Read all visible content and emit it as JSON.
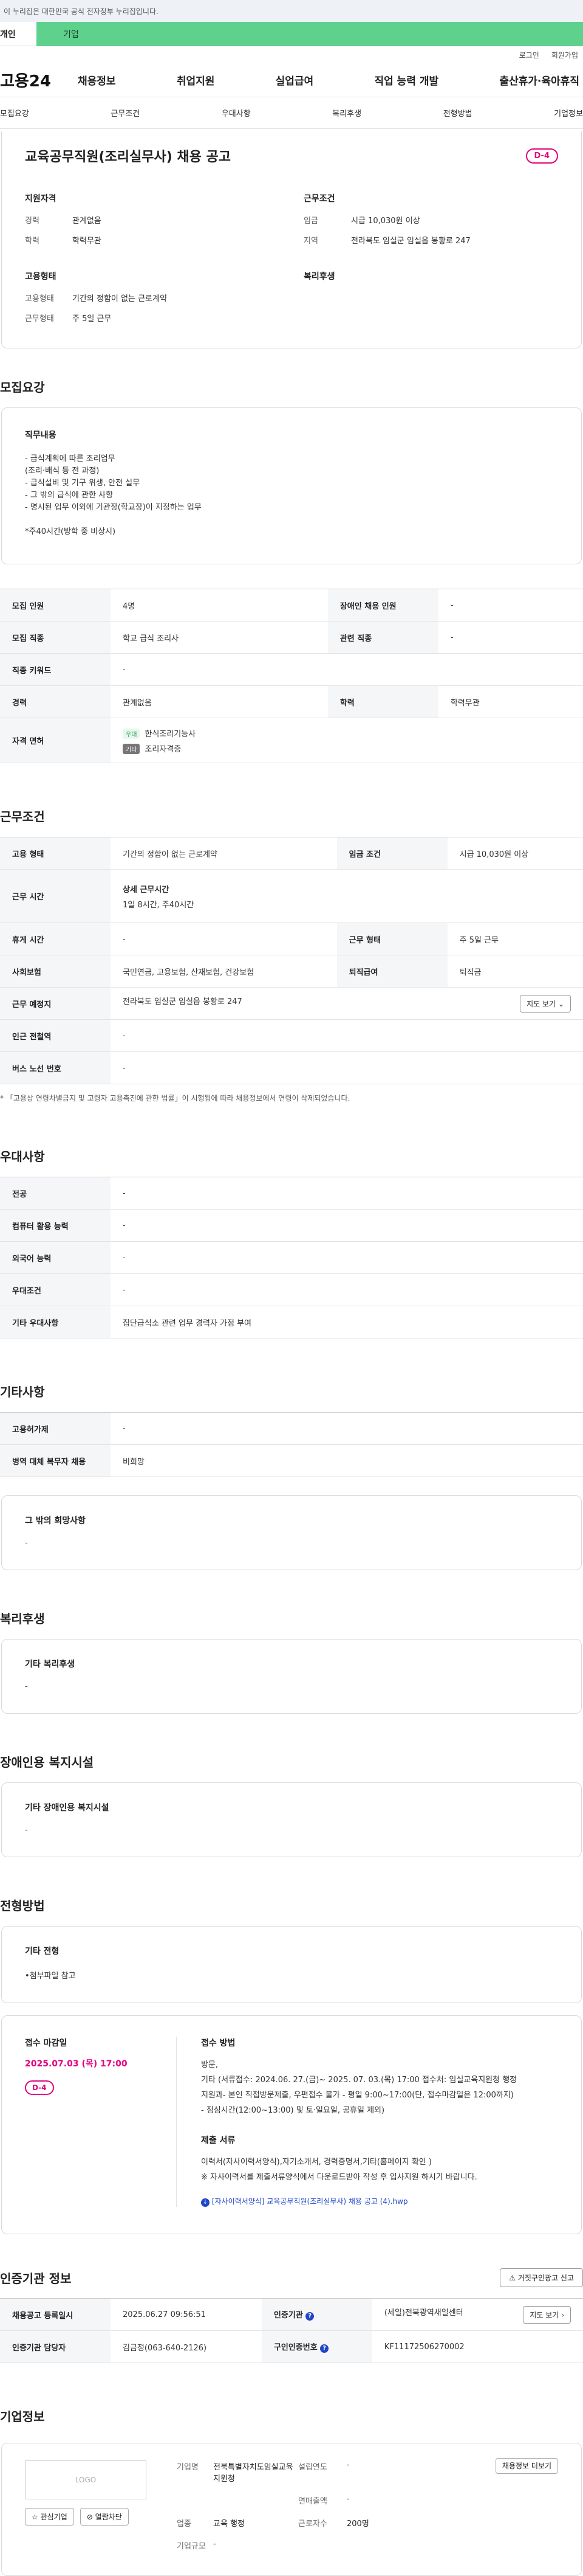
{
  "gov_bar": "이 누리집은 대한민국 공식 전자정부 누리집입니다.",
  "tabs": {
    "personal": "개인",
    "biz": "기업"
  },
  "util": {
    "login": "로그인",
    "signup": "회원가입"
  },
  "logo": "고용24",
  "gnb": [
    "채용정보",
    "취업지원",
    "실업급여",
    "직업 능력 개발",
    "출산휴가·육아휴직"
  ],
  "subnav": [
    "모집요강",
    "근무조건",
    "우대사항",
    "복리후생",
    "전형방법",
    "기업정보"
  ],
  "job": {
    "title": "교육공무직원(조리실무사) 채용 공고",
    "dday": "D-4",
    "qual_head": "지원자격",
    "career_k": "경력",
    "career_v": "관계없음",
    "edu_k": "학력",
    "edu_v": "학력무관",
    "emp_head": "고용형태",
    "emp_k": "고용형태",
    "emp_v": "기간의 정함이 없는 근로계약",
    "work_k": "근무형태",
    "work_v": "주 5일 근무",
    "cond_head": "근무조건",
    "wage_k": "임금",
    "wage_v": "시급 10,030원 이상",
    "loc_k": "지역",
    "loc_v": "전라북도 임실군 임실읍 봉황로 247",
    "welfare_head": "복리후생"
  },
  "sec_recruit": "모집요강",
  "duty": {
    "head": "직무내용",
    "lines": [
      "- 급식계획에 따른 조리업무",
      "  (조리·배식 등 전 과정)",
      "- 급식설비 및 기구 위생, 안전 실무",
      "- 그 밖의 급식에 관한 사항",
      "- 명시된 업무 이외에 기관장(학교장)이 지정하는 업무",
      "",
      "*주40시간(방학 중 비상시)"
    ]
  },
  "recruit_table": {
    "count_k": "모집 인원",
    "count_v": "4명",
    "disabled_k": "장애인 채용 인원",
    "disabled_v": "-",
    "job_k": "모집 직종",
    "job_v": "학교 급식 조리사",
    "related_k": "관련 직종",
    "related_v": "-",
    "keyword_k": "직종 키워드",
    "keyword_v": "-",
    "career_k": "경력",
    "career_v": "관계없음",
    "edu_k": "학력",
    "edu_v": "학력무관",
    "lic_k": "자격 면허",
    "lic1_tag": "우대",
    "lic1": "한식조리기능사",
    "lic2_tag": "기타",
    "lic2": "조리자격증"
  },
  "sec_work": "근무조건",
  "work_table": {
    "emp_k": "고용 형태",
    "emp_v": "기간의 정함이 없는 근로계약",
    "wage_k": "임금 조건",
    "wage_v": "시급 10,030원 이상",
    "time_k": "근무 시간",
    "time_h": "상세 근무시간",
    "time_v": "1일 8시간, 주40시간",
    "rest_k": "휴게 시간",
    "rest_v": "-",
    "type_k": "근무 형태",
    "type_v": "주 5일 근무",
    "ins_k": "사회보험",
    "ins_v": "국민연금, 고용보험, 산재보험, 건강보험",
    "ret_k": "퇴직급여",
    "ret_v": "퇴직금",
    "place_k": "근무 예정지",
    "place_v": "전라북도 임실군 임실읍 봉황로 247",
    "map_btn": "지도 보기",
    "sub_k": "인근 전철역",
    "sub_v": "-",
    "bus_k": "버스 노선 번호",
    "bus_v": "-"
  },
  "work_note": "* 「고용상 연령차별금지 및 고령자 고용촉진에 관한 법률」이 시행됨에 따라 채용정보에서 연령이 삭제되었습니다.",
  "sec_pref": "우대사항",
  "pref_table": {
    "major_k": "전공",
    "major_v": "-",
    "comp_k": "컴퓨터 활용 능력",
    "comp_v": "-",
    "lang_k": "외국어 능력",
    "lang_v": "-",
    "cond_k": "우대조건",
    "cond_v": "-",
    "etc_k": "기타 우대사항",
    "etc_v": "집단급식소 관련 업무 경력자 가점 부여"
  },
  "sec_other": "기타사항",
  "other_table": {
    "hire_k": "고용허가제",
    "hire_v": "-",
    "mil_k": "병역 대체 복무자 채용",
    "mil_v": "비희망"
  },
  "other_card": {
    "h": "그 밖의 희망사항",
    "b": "-"
  },
  "sec_welfare": "복리후생",
  "welfare_card": {
    "h": "기타 복리후생",
    "b": "-"
  },
  "sec_disabled": "장애인용 복지시설",
  "disabled_card": {
    "h": "기타 장애인용 복지시설",
    "b": "-"
  },
  "sec_method": "전형방법",
  "method_card": {
    "h": "기타 전형",
    "b": "•첨부파일 참고"
  },
  "apply": {
    "deadline_h": "접수 마감일",
    "deadline_v": "2025.07.03 (목) 17:00",
    "dday": "D-4",
    "method_h": "접수 방법",
    "method_lines": [
      "방문,",
      "기타 (서류접수: 2024.06. 27.(금)~ 2025. 07. 03.(목) 17:00 접수처: 임실교육지원청 행정",
      "지원과- 본인 직접방문제출, 우편접수 불가 - 평일 9:00~17:00(단, 접수마감일은 12:00까지)",
      "- 점심시간(12:00~13:00) 및 토·일요일, 공휴일 제외)"
    ],
    "docs_h": "제출 서류",
    "docs_lines": [
      "이력서(자사이력서양식),자기소개서, 경력증명서,기타(홈페이지 확인 )",
      "※ 자사이력서를 제출서류양식에서 다운로드받아 작성 후 입사지원 하시기 바랍니다."
    ],
    "file": "[자사이력서양식] 교육공무직원(조리실무사) 채용 공고 (4).hwp"
  },
  "sec_agency": "인증기관 정보",
  "report_btn": "거짓구인광고 신고",
  "agency_table": {
    "reg_k": "채용공고 등록일시",
    "reg_v": "2025.06.27 09:56:51",
    "org_k": "인증기관",
    "org_v": "(세일)전북광역새일센터",
    "map_btn": "지도 보기",
    "mgr_k": "인증기관 담당자",
    "mgr_v": "김금정(063-640-2126)",
    "num_k": "구인인증번호",
    "num_v": "KF11172506270002"
  },
  "sec_company": "기업정보",
  "company": {
    "logo": "LOGO",
    "fav": "관심기업",
    "block": "열람차단",
    "name_k": "기업명",
    "name_v": "전북특별자치도임실교육지원청",
    "year_k": "설립연도",
    "year_v": "-",
    "sales_k": "연매출액",
    "sales_v": "-",
    "ind_k": "업종",
    "ind_v": "교육 행정",
    "emp_k": "근로자수",
    "emp_v": "200명",
    "size_k": "기업규모",
    "size_v": "-",
    "jobs_btn": "채용정보 더보기"
  }
}
